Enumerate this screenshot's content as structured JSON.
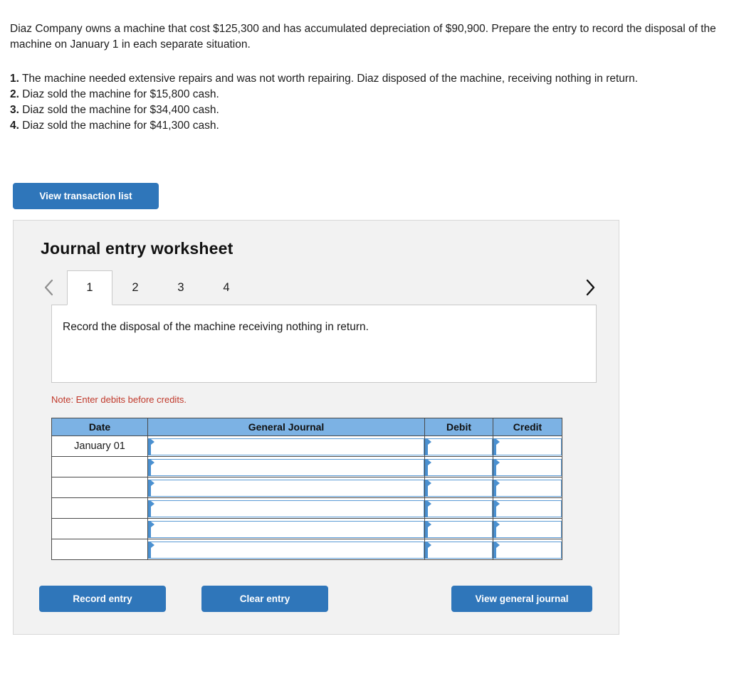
{
  "colors": {
    "button_blue": "#2f76ba",
    "table_header_blue": "#7cb2e4",
    "field_blue": "#4a90d0",
    "note_red": "#c0392b",
    "panel_gray": "#f2f2f2"
  },
  "problem": {
    "statement": "Diaz Company owns a machine that cost $125,300 and has accumulated depreciation of $90,900. Prepare the entry to record the disposal of the machine on January 1 in each separate situation.",
    "situations": [
      {
        "number": "1.",
        "text": "The machine needed extensive repairs and was not worth repairing. Diaz disposed of the machine, receiving nothing in return."
      },
      {
        "number": "2.",
        "text": "Diaz sold the machine for $15,800 cash."
      },
      {
        "number": "3.",
        "text": "Diaz sold the machine for $34,400 cash."
      },
      {
        "number": "4.",
        "text": "Diaz sold the machine for $41,300 cash."
      }
    ]
  },
  "toolbar": {
    "view_transaction_list_label": "View transaction list"
  },
  "worksheet": {
    "title": "Journal entry worksheet",
    "nav": {
      "prev_icon": "chevron-left-icon",
      "next_icon": "chevron-right-icon",
      "prev_enabled": false,
      "next_enabled": true
    },
    "tabs": [
      {
        "label": "1",
        "active": true
      },
      {
        "label": "2",
        "active": false
      },
      {
        "label": "3",
        "active": false
      },
      {
        "label": "4",
        "active": false
      }
    ],
    "instruction": "Record the disposal of the machine receiving nothing in return.",
    "note": "Note: Enter debits before credits.",
    "table": {
      "headers": [
        "Date",
        "General Journal",
        "Debit",
        "Credit"
      ],
      "rows": [
        {
          "date": "January 01",
          "general_journal": "",
          "debit": "",
          "credit": ""
        },
        {
          "date": "",
          "general_journal": "",
          "debit": "",
          "credit": ""
        },
        {
          "date": "",
          "general_journal": "",
          "debit": "",
          "credit": ""
        },
        {
          "date": "",
          "general_journal": "",
          "debit": "",
          "credit": ""
        },
        {
          "date": "",
          "general_journal": "",
          "debit": "",
          "credit": ""
        },
        {
          "date": "",
          "general_journal": "",
          "debit": "",
          "credit": ""
        }
      ]
    },
    "actions": {
      "record_entry_label": "Record entry",
      "clear_entry_label": "Clear entry",
      "view_general_journal_label": "View general journal"
    }
  }
}
